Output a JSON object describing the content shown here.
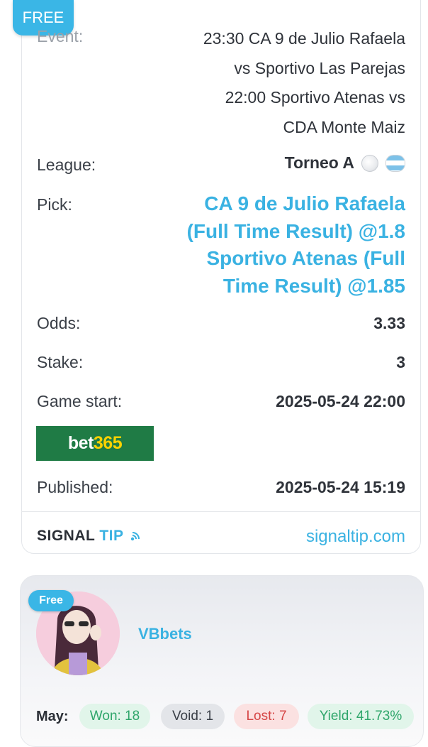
{
  "tip_card": {
    "badge": "FREE",
    "event": {
      "label": "Event:",
      "lines": [
        "23:30 CA 9 de Julio Rafaela",
        "vs Sportivo Las Parejas",
        "22:00 Sportivo Atenas vs",
        "CDA Monte Maiz"
      ]
    },
    "league": {
      "label": "League:",
      "value": "Torneo A",
      "icons": [
        "soccer-ball-icon",
        "argentina-flag-icon"
      ]
    },
    "pick": {
      "label": "Pick:",
      "lines": [
        "CA 9 de Julio Rafaela",
        "(Full Time Result) @1.8",
        "Sportivo Atenas (Full",
        "Time Result) @1.85"
      ]
    },
    "odds": {
      "label": "Odds:",
      "value": "3.33"
    },
    "stake": {
      "label": "Stake:",
      "value": "3"
    },
    "game_start": {
      "label": "Game start:",
      "value": "2025-05-24 22:00"
    },
    "bookmaker": {
      "part1": "bet",
      "part2": "365"
    },
    "published": {
      "label": "Published:",
      "value": "2025-05-24 15:19"
    },
    "footer": {
      "brand_part1": "SIGNAL",
      "brand_part2": "TIP",
      "site": "signaltip.com"
    }
  },
  "tipster_card": {
    "badge": "Free",
    "name": "VBbets",
    "stats": {
      "month_label": "May:",
      "won": "Won: 18",
      "void": "Void: 1",
      "lost": "Lost: 7",
      "yield": "Yield: 41.73%"
    }
  },
  "colors": {
    "accent": "#3ab2e2",
    "bet365_green": "#1f7b45",
    "bet365_yellow": "#ffd200",
    "won_green": "#2fa66b",
    "lost_red": "#d64646"
  }
}
